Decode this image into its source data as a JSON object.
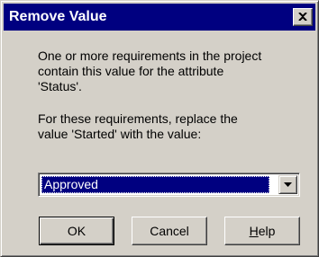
{
  "dialog": {
    "title": "Remove Value",
    "close_icon": "close-icon",
    "message_line_1": "One or more requirements in the project",
    "message_line_2": "contain this value for the attribute",
    "message_line_3": "'Status'.",
    "message_line_4": "For these requirements, replace the",
    "message_line_5": "value 'Started' with the value:",
    "select": {
      "value": "Approved",
      "dropdown_icon": "chevron-down-icon"
    },
    "buttons": {
      "ok": "OK",
      "cancel": "Cancel",
      "help_mnemonic": "H",
      "help_rest": "elp"
    },
    "colors": {
      "face": "#d4d0c8",
      "titlebar": "#000080",
      "selection": "#000080"
    }
  }
}
